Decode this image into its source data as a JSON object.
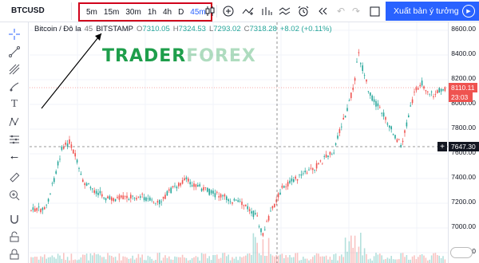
{
  "toolbar": {
    "symbol": "BTCUSD",
    "timeframes": [
      "5m",
      "15m",
      "30m",
      "1h",
      "4h",
      "D",
      "45m"
    ],
    "active_timeframe": "45m",
    "publish_label": "Xuất bản ý tưởng"
  },
  "legend": {
    "name": "Bitcoin / Đô la",
    "interval": "45",
    "exchange": "BITSTAMP",
    "o_label": "O",
    "o_value": "7310.05",
    "h_label": "H",
    "h_value": "7324.53",
    "l_label": "L",
    "l_value": "7293.02",
    "c_label": "C",
    "c_value": "7318.28",
    "change": "+8.02 (+0.11%)"
  },
  "watermark": {
    "part1": "TRADER",
    "part2": "FOREX"
  },
  "price_axis": {
    "ticks": [
      "8600.00",
      "8400.00",
      "8200.00",
      "8000.00",
      "7800.00",
      "7600.00",
      "7400.00",
      "7200.00",
      "7000.00",
      "6800.00"
    ],
    "current_price": "8110.11",
    "countdown": "23:03",
    "crosshair_price": "7647.30"
  },
  "colors": {
    "up": "#26a69a",
    "down": "#ef5350",
    "accent": "#2962ff",
    "highlight": "#d0021b",
    "watermark": "#1e9e4b"
  }
}
